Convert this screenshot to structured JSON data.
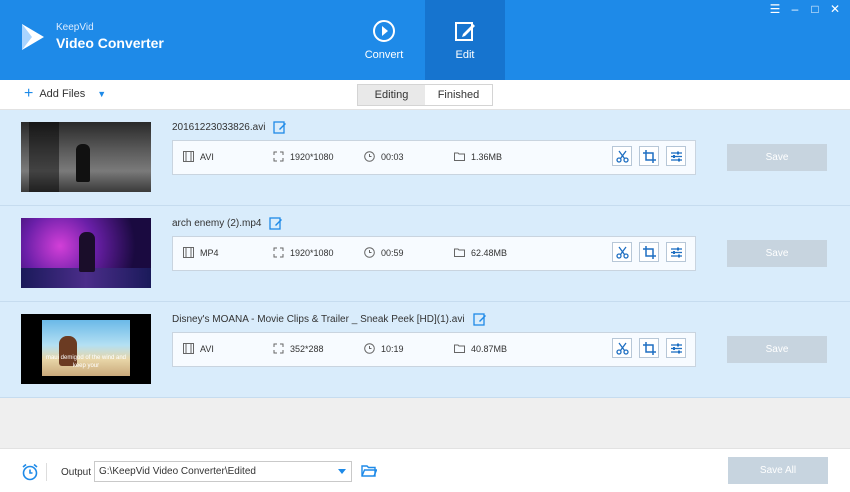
{
  "app": {
    "brand_small": "KeepVid",
    "brand_big": "Video Converter"
  },
  "nav": {
    "convert": "Convert",
    "edit": "Edit"
  },
  "toolbar": {
    "add_files": "Add Files",
    "tab_editing": "Editing",
    "tab_finished": "Finished"
  },
  "files": [
    {
      "name": "20161223033826.avi",
      "format": "AVI",
      "resolution": "1920*1080",
      "duration": "00:03",
      "size": "1.36MB",
      "save": "Save"
    },
    {
      "name": "arch enemy (2).mp4",
      "format": "MP4",
      "resolution": "1920*1080",
      "duration": "00:59",
      "size": "62.48MB",
      "save": "Save"
    },
    {
      "name": "Disney's MOANA - Movie Clips & Trailer _ Sneak Peek [HD](1).avi",
      "format": "AVI",
      "resolution": "352*288",
      "duration": "10:19",
      "size": "40.87MB",
      "save": "Save"
    }
  ],
  "thumb3_subtitle": "maui demigod of the wind and\nkeep your",
  "footer": {
    "output_label": "Output",
    "output_path": "G:\\KeepVid Video Converter\\Edited",
    "save_all": "Save All"
  },
  "colors": {
    "primary": "#1e8ae8",
    "row_bg": "#d9ecfb",
    "disabled_btn": "#c7d4df"
  }
}
